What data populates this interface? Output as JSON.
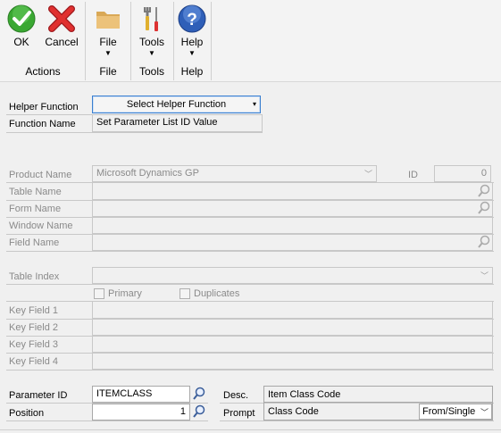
{
  "ribbon": {
    "ok_label": "OK",
    "cancel_label": "Cancel",
    "actions_group": "Actions",
    "file_label": "File",
    "file_group": "File",
    "tools_label": "Tools",
    "tools_group": "Tools",
    "help_label": "Help",
    "help_group": "Help",
    "menu_arrow": "▼"
  },
  "helper": {
    "helper_function_label": "Helper Function",
    "select_button": "Select Helper Function",
    "function_name_label": "Function Name",
    "function_name_value": "Set Parameter List ID Value"
  },
  "product": {
    "product_name_label": "Product Name",
    "product_name_value": "Microsoft Dynamics GP",
    "id_label": "ID",
    "id_value": "0",
    "table_name_label": "Table Name",
    "form_name_label": "Form Name",
    "window_name_label": "Window Name",
    "field_name_label": "Field Name"
  },
  "index": {
    "table_index_label": "Table Index",
    "primary_label": "Primary",
    "duplicates_label": "Duplicates",
    "key_field_1": "Key Field 1",
    "key_field_2": "Key Field 2",
    "key_field_3": "Key Field 3",
    "key_field_4": "Key Field 4"
  },
  "param": {
    "parameter_id_label": "Parameter ID",
    "parameter_id_value": "ITEMCLASS",
    "position_label": "Position",
    "position_value": "1",
    "desc_label": "Desc.",
    "desc_value": "Item Class Code",
    "prompt_label": "Prompt",
    "prompt_value": "Class Code",
    "prompt_type_value": "From/Single"
  },
  "colors": {
    "ok_green": "#3aa832",
    "cancel_red": "#d9262b",
    "help_blue": "#2f5fb8",
    "folder_tan": "#e2b56a"
  }
}
